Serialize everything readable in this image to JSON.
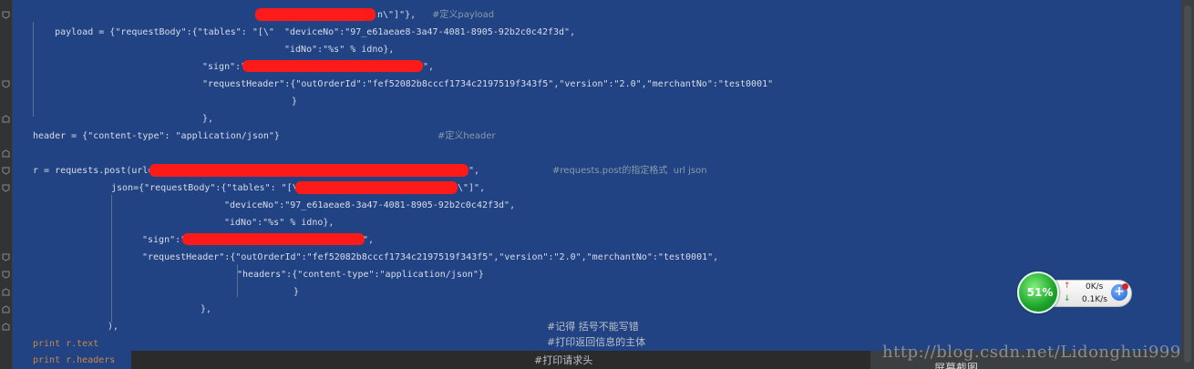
{
  "editor": {
    "lines": [
      {
        "id": "l1",
        "text": "payload = {\"requestBody\":{\"tables\": \"[\\\"",
        "tail": "n\\\"]\"},",
        "comment": "#定义payload"
      },
      {
        "id": "l2",
        "text": "\"deviceNo\":\"97_e61aeae8-3a47-4081-8905-92b2c0c42f3d\","
      },
      {
        "id": "l3",
        "text": "\"idNo\":\"%s\" % idno},"
      },
      {
        "id": "l4",
        "text": "\"sign\":\"",
        "tail": "\","
      },
      {
        "id": "l5",
        "text": "\"requestHeader\":{\"outOrderId\":\"fef52082b8cccf1734c2197519f343f5\",\"version\":\"2.0\",\"merchantNo\":\"test0001\""
      },
      {
        "id": "l6",
        "text": "}"
      },
      {
        "id": "l7",
        "text": "},"
      },
      {
        "id": "l8",
        "text": "header = {\"content-type\": \"application/json\"}",
        "comment": "#定义header"
      },
      {
        "id": "l10",
        "text": "r = requests.post(url=\"",
        "tail": "\",",
        "comment": "#requests.post的指定格式  url json"
      },
      {
        "id": "l11",
        "text": "json={\"requestBody\":{\"tables\": \"[\\\"",
        "tail": "\\\"]\","
      },
      {
        "id": "l12",
        "text": "\"deviceNo\":\"97_e61aeae8-3a47-4081-8905-92b2c0c42f3d\","
      },
      {
        "id": "l13",
        "text": "\"idNo\":\"%s\" % idno},"
      },
      {
        "id": "l14",
        "text": "\"sign\":\"",
        "tail": "\","
      },
      {
        "id": "l15",
        "text": "\"requestHeader\":{\"outOrderId\":\"fef52082b8cccf1734c2197519f343f5\",\"version\":\"2.0\",\"merchantNo\":\"test0001\","
      },
      {
        "id": "l16",
        "text": "\"headers\":{\"content-type\":\"application/json\"}"
      },
      {
        "id": "l17",
        "text": "}"
      },
      {
        "id": "l18",
        "text": "},"
      },
      {
        "id": "l19",
        "text": "),",
        "comment": "#记得 括号不能写错"
      },
      {
        "id": "l20",
        "text": "print r.text",
        "comment": "#打印返回信息的主体"
      },
      {
        "id": "l21",
        "text": "print r.headers",
        "comment": "#打印请求头"
      }
    ]
  },
  "watermark": "http://blog.csdn.net/Lidonghui999",
  "taskbar": {
    "label": "屏幕截图"
  },
  "net_widget": {
    "percent": "51%",
    "upload": "0K/s",
    "download": "0.1K/s",
    "plus": "+"
  },
  "colors": {
    "editor_bg": "#214283",
    "redaction": "#ff1a1a",
    "keyword": "#cc8844"
  }
}
